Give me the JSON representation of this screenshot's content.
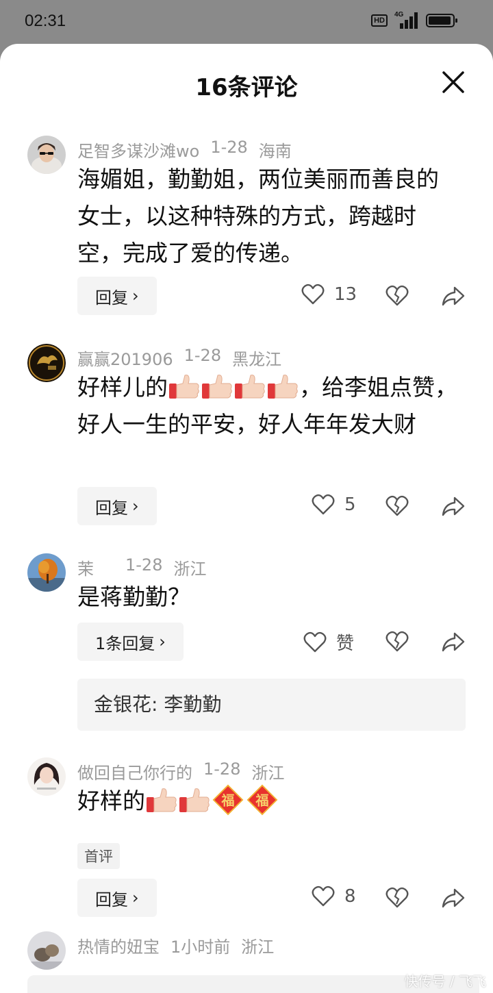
{
  "status_bar": {
    "time": "02:31",
    "hd_label": "HD",
    "network_label": "4G"
  },
  "header": {
    "title": "16条评论"
  },
  "comments": [
    {
      "username": "足智多谋沙滩wo",
      "date": "1-28",
      "location": "海南",
      "text": "海媚姐，勤勤姐，两位美丽而善良的女士，以这种特殊的方式，跨越时空，完成了爱的传递。",
      "reply_label": "回复",
      "likes": "13"
    },
    {
      "username": "赢赢201906",
      "date": "1-28",
      "location": "黑龙江",
      "text_before": "好样儿的",
      "text_after": "，给李姐点赞，好人一生的平安，好人年年发大财",
      "reply_label": "回复",
      "likes": "5"
    },
    {
      "username": "茉",
      "date": "1-28",
      "location": "浙江",
      "text": "是蒋勤勤？",
      "reply_label": "1条回复",
      "likes": "赞",
      "sub_reply": "金银花: 李勤勤"
    },
    {
      "username": "做回自己你行的",
      "date": "1-28",
      "location": "浙江",
      "text": "好样的",
      "badge": "首评",
      "reply_label": "回复",
      "likes": "8"
    },
    {
      "username": "热情的妞宝",
      "date": "1小时前",
      "location": "浙江"
    }
  ],
  "emoji": {
    "fu_char": "福"
  },
  "watermark": "快传号 / 飞飞"
}
